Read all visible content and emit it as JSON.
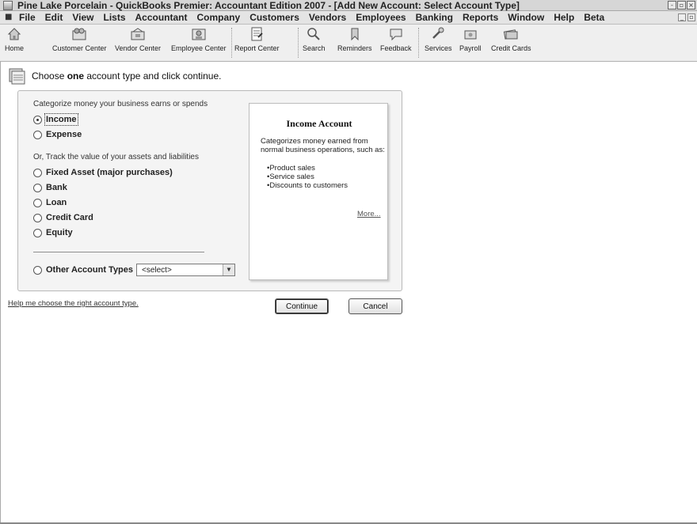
{
  "window": {
    "title": "Pine Lake Porcelain - QuickBooks Premier: Accountant Edition 2007 - [Add New Account: Select Account Type]",
    "buttons": [
      "-",
      "▫",
      "×"
    ],
    "mdi_buttons": [
      "_",
      "▫",
      "×"
    ]
  },
  "menubar": {
    "items": [
      "File",
      "Edit",
      "View",
      "Lists",
      "Accountant",
      "Company",
      "Customers",
      "Vendors",
      "Employees",
      "Banking",
      "Reports",
      "Window",
      "Help",
      "Beta"
    ]
  },
  "toolbar": {
    "items": [
      {
        "label": "Home",
        "icon": "home-icon"
      },
      {
        "label": "Customer Center",
        "icon": "customer-center-icon"
      },
      {
        "label": "Vendor Center",
        "icon": "vendor-center-icon"
      },
      {
        "label": "Employee Center",
        "icon": "employee-center-icon"
      },
      {
        "label": "Report Center",
        "icon": "report-center-icon"
      },
      {
        "label": "Search",
        "icon": "search-icon"
      },
      {
        "label": "Reminders",
        "icon": "reminders-icon"
      },
      {
        "label": "Feedback",
        "icon": "feedback-icon"
      },
      {
        "label": "Services",
        "icon": "services-icon"
      },
      {
        "label": "Payroll",
        "icon": "payroll-icon"
      },
      {
        "label": "Credit Cards",
        "icon": "credit-cards-icon"
      }
    ]
  },
  "header": {
    "prefix": "Choose ",
    "emphasis": "one",
    "suffix": " account type and click continue."
  },
  "categorize": {
    "heading": "Categorize money your business earns or spends",
    "options": [
      {
        "label": "Income",
        "checked": true
      },
      {
        "label": "Expense",
        "checked": false
      }
    ]
  },
  "track": {
    "heading": "Or, Track the value of your assets and liabilities",
    "options": [
      {
        "label": "Fixed Asset (major purchases)",
        "checked": false
      },
      {
        "label": "Bank",
        "checked": false
      },
      {
        "label": "Loan",
        "checked": false
      },
      {
        "label": "Credit Card",
        "checked": false
      },
      {
        "label": "Equity",
        "checked": false
      }
    ]
  },
  "other": {
    "label": "Other Account Types",
    "select_value": "<select>"
  },
  "info_panel": {
    "title": "Income Account",
    "description": "Categorizes money earned from normal business operations, such as:",
    "bullets": [
      "Product sales",
      "Service sales",
      "Discounts to customers"
    ],
    "more": "More..."
  },
  "footer": {
    "help_link": "Help me choose the right account type.",
    "continue": "Continue",
    "cancel": "Cancel"
  }
}
